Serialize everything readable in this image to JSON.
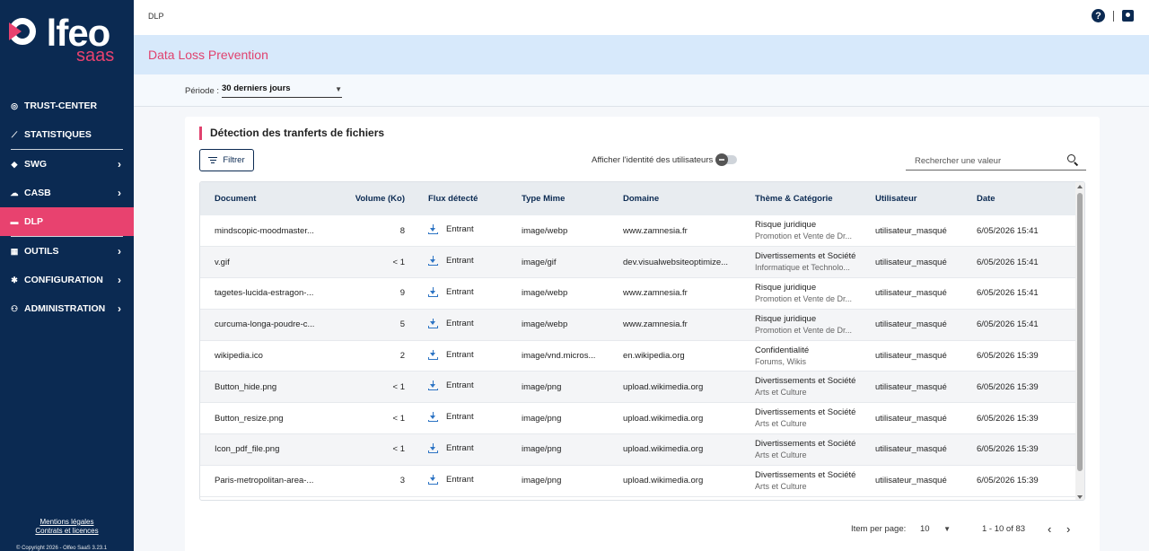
{
  "brand": {
    "name": "Olfeo",
    "sub": "saas"
  },
  "sidebar": {
    "items": [
      {
        "label": "TRUST-CENTER",
        "icon": "target-icon",
        "chevron": false
      },
      {
        "label": "STATISTIQUES",
        "icon": "chart-icon",
        "chevron": false
      },
      {
        "label": "SWG",
        "icon": "shield-icon",
        "chevron": true
      },
      {
        "label": "CASB",
        "icon": "cloud-icon",
        "chevron": true
      },
      {
        "label": "DLP",
        "icon": "folder-icon",
        "chevron": false,
        "active": true
      },
      {
        "label": "OUTILS",
        "icon": "grid-icon",
        "chevron": true
      },
      {
        "label": "CONFIGURATION",
        "icon": "gear-icon",
        "chevron": true
      },
      {
        "label": "ADMINISTRATION",
        "icon": "users-icon",
        "chevron": true
      }
    ],
    "footer": {
      "legal": "Mentions légales",
      "licences": "Contrats et licences",
      "copyright": "© Copyright 2026 - Olfeo SaaS 3.23.1"
    }
  },
  "topbar": {
    "breadcrumb": "DLP"
  },
  "page": {
    "title": "Data Loss Prevention"
  },
  "period": {
    "label": "Période :",
    "value": "30 derniers jours"
  },
  "card": {
    "title": "Détection des tranferts de fichiers",
    "filter_label": "Filtrer",
    "toggle_label": "Afficher l'identité des utilisateurs",
    "search_placeholder": "Rechercher une valeur"
  },
  "table": {
    "columns": [
      "Document",
      "Volume (Ko)",
      "Flux détecté",
      "Type Mime",
      "Domaine",
      "Thème & Catégorie",
      "Utilisateur",
      "Date"
    ],
    "rows": [
      {
        "document": "mindscopic-moodmaster...",
        "volume": "8",
        "flux": "Entrant",
        "mime": "image/webp",
        "domain": "www.zamnesia.fr",
        "theme": "Risque juridique",
        "category": "Promotion et Vente de Dr...",
        "user": "utilisateur_masqué",
        "date": "6/05/2026 15:41"
      },
      {
        "document": "v.gif",
        "volume": "< 1",
        "flux": "Entrant",
        "mime": "image/gif",
        "domain": "dev.visualwebsiteoptimize...",
        "theme": "Divertissements et Société",
        "category": "Informatique et Technolo...",
        "user": "utilisateur_masqué",
        "date": "6/05/2026 15:41"
      },
      {
        "document": "tagetes-lucida-estragon-...",
        "volume": "9",
        "flux": "Entrant",
        "mime": "image/webp",
        "domain": "www.zamnesia.fr",
        "theme": "Risque juridique",
        "category": "Promotion et Vente de Dr...",
        "user": "utilisateur_masqué",
        "date": "6/05/2026 15:41"
      },
      {
        "document": "curcuma-longa-poudre-c...",
        "volume": "5",
        "flux": "Entrant",
        "mime": "image/webp",
        "domain": "www.zamnesia.fr",
        "theme": "Risque juridique",
        "category": "Promotion et Vente de Dr...",
        "user": "utilisateur_masqué",
        "date": "6/05/2026 15:41"
      },
      {
        "document": "wikipedia.ico",
        "volume": "2",
        "flux": "Entrant",
        "mime": "image/vnd.micros...",
        "domain": "en.wikipedia.org",
        "theme": "Confidentialité",
        "category": "Forums, Wikis",
        "user": "utilisateur_masqué",
        "date": "6/05/2026 15:39"
      },
      {
        "document": "Button_hide.png",
        "volume": "< 1",
        "flux": "Entrant",
        "mime": "image/png",
        "domain": "upload.wikimedia.org",
        "theme": "Divertissements et Société",
        "category": "Arts et Culture",
        "user": "utilisateur_masqué",
        "date": "6/05/2026 15:39"
      },
      {
        "document": "Button_resize.png",
        "volume": "< 1",
        "flux": "Entrant",
        "mime": "image/png",
        "domain": "upload.wikimedia.org",
        "theme": "Divertissements et Société",
        "category": "Arts et Culture",
        "user": "utilisateur_masqué",
        "date": "6/05/2026 15:39"
      },
      {
        "document": "Icon_pdf_file.png",
        "volume": "< 1",
        "flux": "Entrant",
        "mime": "image/png",
        "domain": "upload.wikimedia.org",
        "theme": "Divertissements et Société",
        "category": "Arts et Culture",
        "user": "utilisateur_masqué",
        "date": "6/05/2026 15:39"
      },
      {
        "document": "Paris-metropolitan-area-...",
        "volume": "3",
        "flux": "Entrant",
        "mime": "image/png",
        "domain": "upload.wikimedia.org",
        "theme": "Divertissements et Société",
        "category": "Arts et Culture",
        "user": "utilisateur_masqué",
        "date": "6/05/2026 15:39"
      }
    ]
  },
  "pagination": {
    "label": "Item per page:",
    "per_page": "10",
    "range": "1 - 10 of 83"
  },
  "colors": {
    "sidebar": "#0b2a52",
    "accent": "#e8426f",
    "title_band": "#d7e9fb",
    "link_icon": "#2d74c4"
  }
}
